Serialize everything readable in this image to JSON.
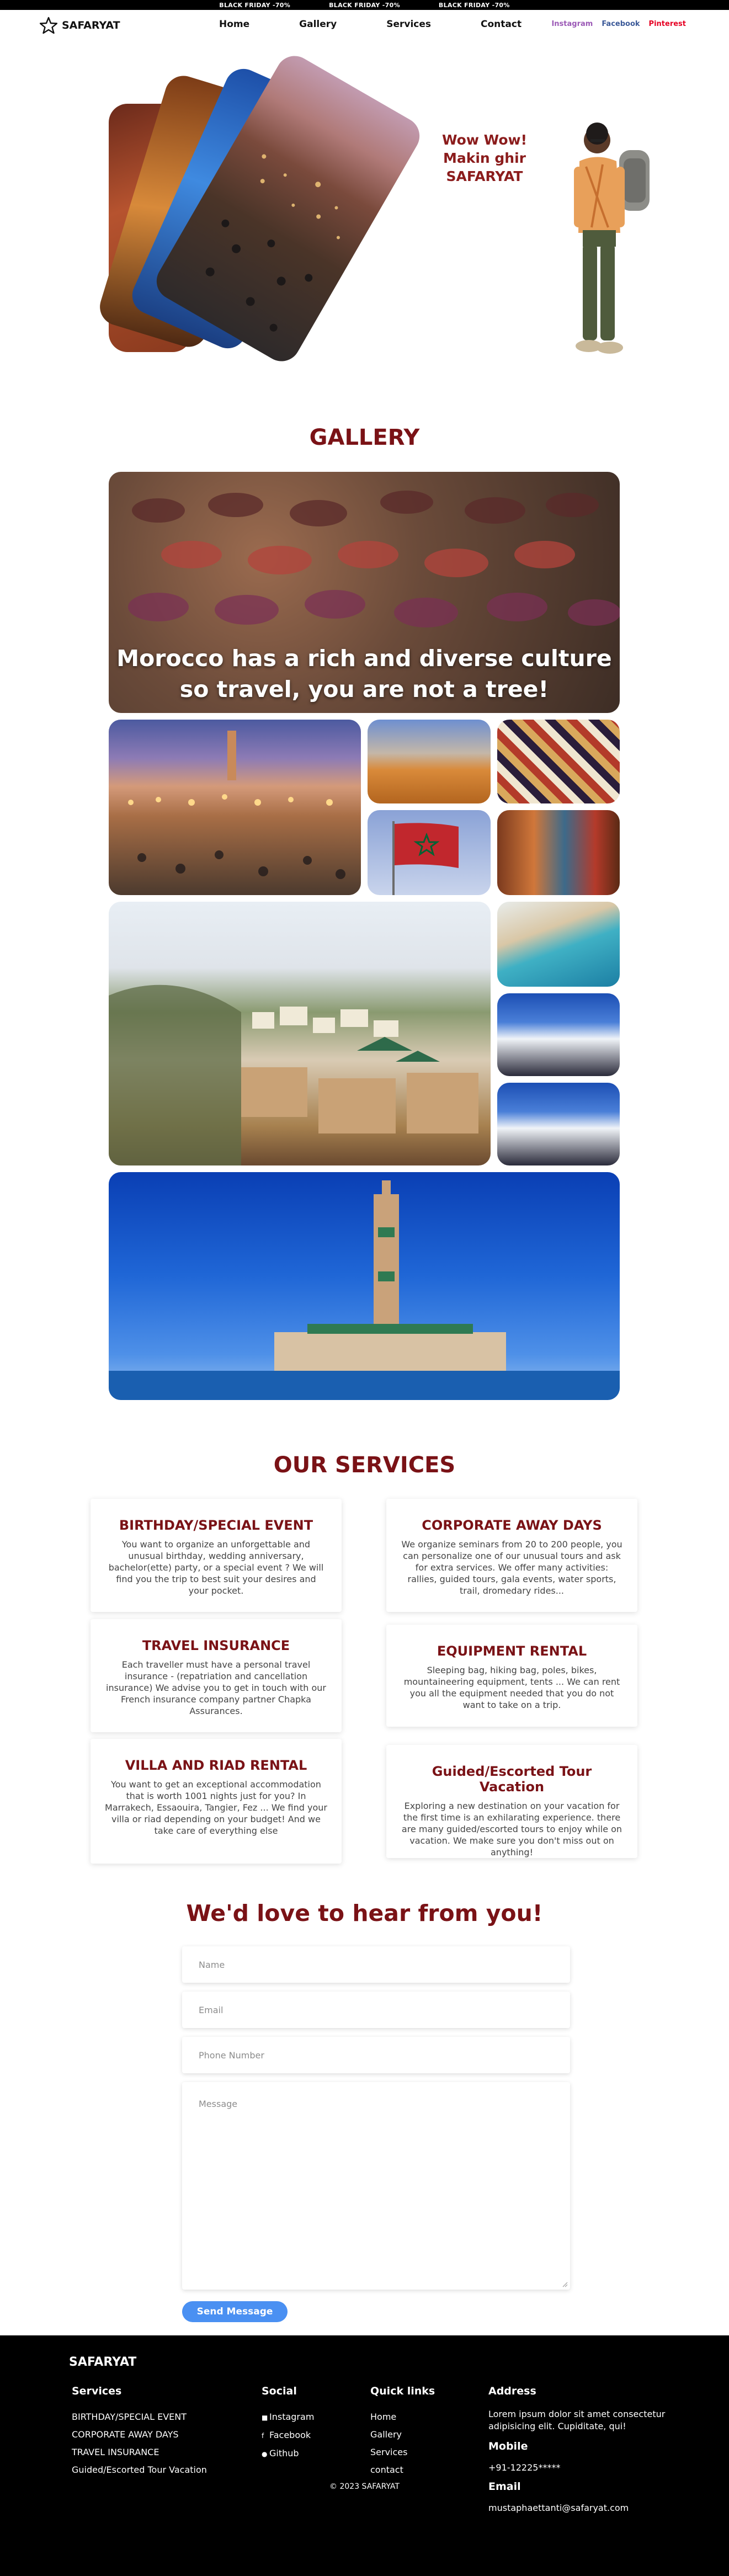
{
  "promo": {
    "items": [
      "BLACK FRIDAY -70%",
      "BLACK FRIDAY -70%",
      "BLACK FRIDAY -70%"
    ]
  },
  "nav": {
    "brand": "SAFARYAT",
    "links": [
      "Home",
      "Gallery",
      "Services",
      "Contact"
    ],
    "social": [
      {
        "label": "Instagram",
        "color": "#9b59b6"
      },
      {
        "label": "Facebook",
        "color": "#3b5998"
      },
      {
        "label": "Pinterest",
        "color": "#e60023"
      }
    ]
  },
  "hero": {
    "line1": "Wow Wow!",
    "line2": "Makin ghir SAFARYAT"
  },
  "gallery": {
    "title": "GALLERY",
    "banner_line1": "Morocco has a rich and diverse culture",
    "banner_line2": "so travel, you are not a tree!"
  },
  "services": {
    "title": "OUR SERVICES",
    "items": [
      {
        "title": "BIRTHDAY/SPECIAL EVENT",
        "text": "You want to organize an unforgettable and unusual birthday, wedding anniversary, bachelor(ette) party, or a special event ? We will find you the trip to best suit your desires and your pocket."
      },
      {
        "title": "CORPORATE AWAY DAYS",
        "text": "We organize seminars from 20 to 200 people, you can personalize one of our unusual tours and ask for extra services. We offer many activities: rallies, guided tours, gala events, water sports, trail, dromedary rides..."
      },
      {
        "title": "TRAVEL INSURANCE",
        "text": "Each traveller must have a personal travel insurance - (repatriation and cancellation insurance) We advise you to get in touch with our French insurance company partner Chapka Assurances."
      },
      {
        "title": "EQUIPMENT RENTAL",
        "text": "Sleeping bag, hiking bag, poles, bikes, mountaineering equipment, tents ... We can rent you all the equipment needed that you do not want to take on a trip."
      },
      {
        "title": "VILLA AND RIAD RENTAL",
        "text": "You want to get an exceptional accommodation that is worth 1001 nights just for you? In Marrakech, Essaouira, Tangier, Fez ... We find your villa or riad depending on your budget! And we take care of everything else"
      },
      {
        "title": "Guided/Escorted Tour Vacation",
        "text": "Exploring a new destination on your vacation for the first time is an exhilarating experience. there are many guided/escorted tours to enjoy while on vacation. We make sure you don't miss out on anything!"
      }
    ]
  },
  "contact": {
    "title": "We'd love to hear from you!",
    "name_placeholder": "Name",
    "email_placeholder": "Email",
    "phone_placeholder": "Phone Number",
    "message_placeholder": "Message",
    "send_label": "Send Message"
  },
  "footer": {
    "brand": "SAFARYAT",
    "services_title": "Services",
    "services": [
      "BIRTHDAY/SPECIAL EVENT",
      "CORPORATE AWAY DAYS",
      "TRAVEL INSURANCE",
      "Guided/Escorted Tour Vacation"
    ],
    "social_title": "Social",
    "social": [
      "Instagram",
      "Facebook",
      "Github"
    ],
    "quick_title": "Quick links",
    "quick": [
      "Home",
      "Gallery",
      "Services",
      "contact"
    ],
    "address_title": "Address",
    "address_line1": "Lorem ipsum dolor sit amet consectetur",
    "address_line2": "adipisicing elit. Cupiditate, qui!",
    "mobile_title": "Mobile",
    "mobile": "+91-12225*****",
    "email_title": "Email",
    "email": "mustaphaettanti@safaryat.com",
    "copyright": "© 2023 SAFARYAT"
  }
}
